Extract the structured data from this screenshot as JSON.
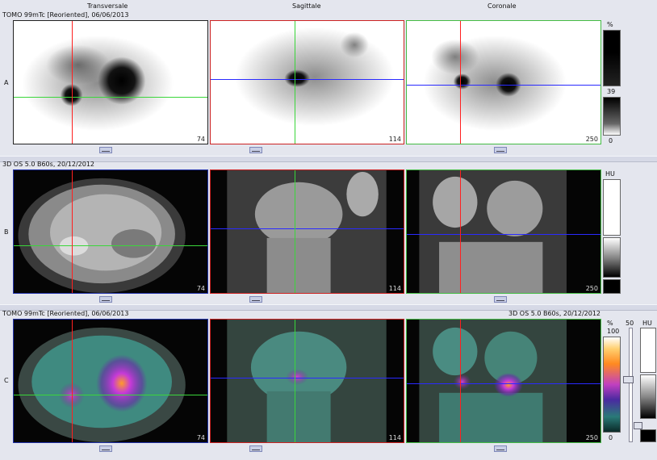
{
  "columns": [
    "Transversale",
    "Sagittale",
    "Coronale"
  ],
  "rows": {
    "a": {
      "label": "A",
      "title": "TOMO 99mTc [Reoriented], 06/06/2013",
      "scale_unit": "%",
      "scale_max": "39",
      "scale_min": "0"
    },
    "b": {
      "label": "B",
      "title": "3D  OS  5.0  B60s, 20/12/2012",
      "scale_unit": "HU"
    },
    "c": {
      "label": "C",
      "title": "TOMO 99mTc [Reoriented], 06/06/2013",
      "title_right": "3D  OS  5.0  B60s, 20/12/2012",
      "scale_unit": "%",
      "scale_max": "100",
      "scale_min": "0",
      "slider_label": "50",
      "scale2_unit": "HU"
    }
  },
  "slices": {
    "transversale": "74",
    "sagittale": "114",
    "coronale": "250"
  },
  "colors": {
    "red": "#ff2020",
    "green": "#3ad63a",
    "blue": "#2a2aff",
    "border_red": "#cc2222",
    "border_green": "#44bb44",
    "border_blue": "#2233aa"
  }
}
